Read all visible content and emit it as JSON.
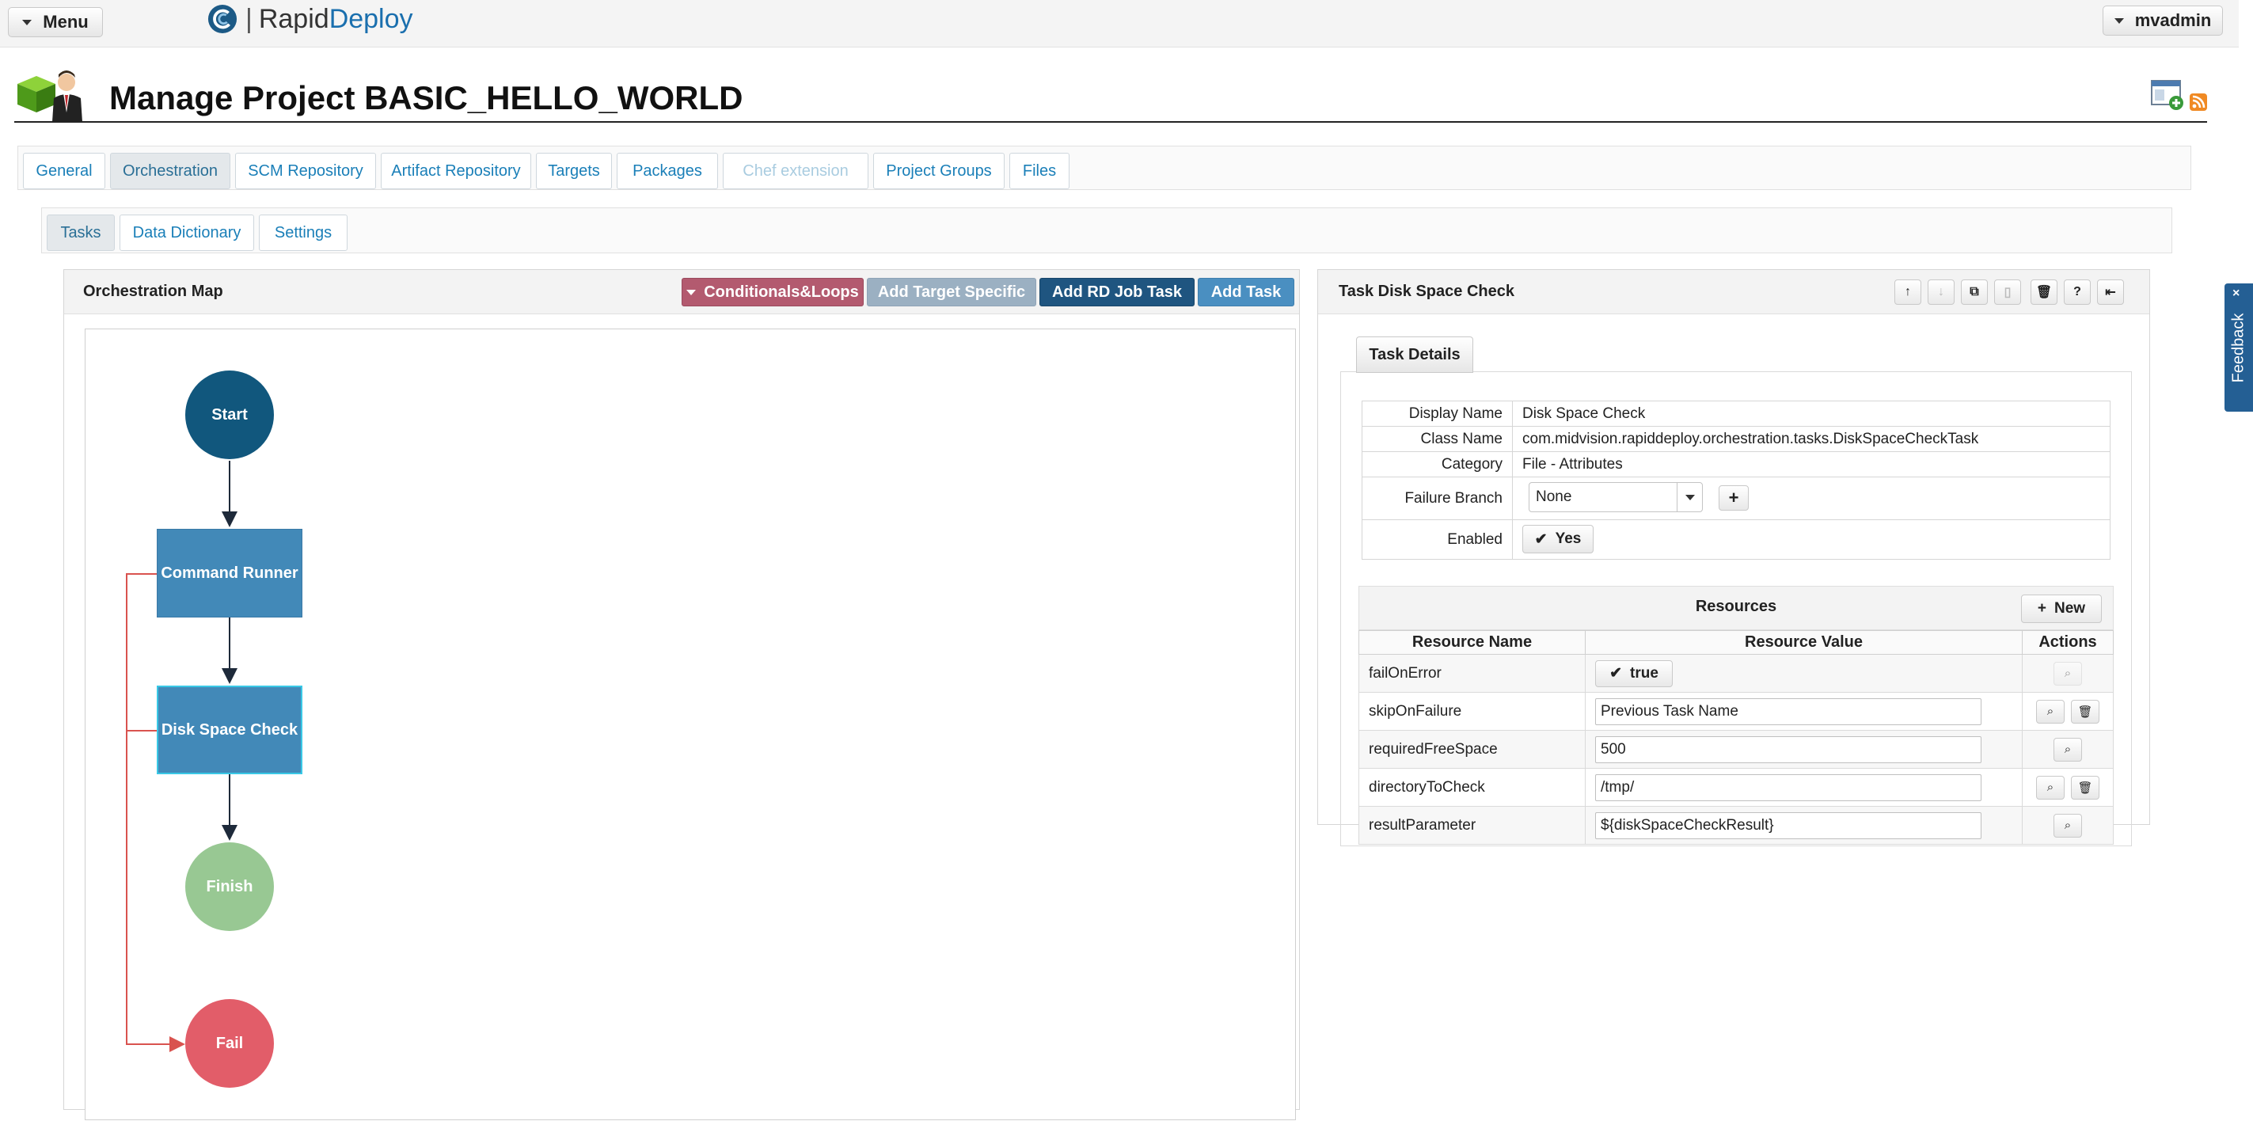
{
  "topbar": {
    "menu_label": "Menu",
    "brand": {
      "part1": "Rapid",
      "part2": "Deploy"
    },
    "user_label": "mvadmin"
  },
  "page": {
    "title": "Manage Project BASIC_HELLO_WORLD"
  },
  "main_tabs": [
    {
      "label": "General",
      "state": "normal"
    },
    {
      "label": "Orchestration",
      "state": "active"
    },
    {
      "label": "SCM Repository",
      "state": "normal"
    },
    {
      "label": "Artifact Repository",
      "state": "normal"
    },
    {
      "label": "Targets",
      "state": "normal"
    },
    {
      "label": "Packages",
      "state": "normal"
    },
    {
      "label": "Chef extension",
      "state": "disabled"
    },
    {
      "label": "Project Groups",
      "state": "normal"
    },
    {
      "label": "Files",
      "state": "normal"
    }
  ],
  "sub_tabs": [
    {
      "label": "Tasks",
      "state": "active"
    },
    {
      "label": "Data Dictionary",
      "state": "normal"
    },
    {
      "label": "Settings",
      "state": "normal"
    }
  ],
  "map": {
    "title": "Orchestration Map",
    "buttons": {
      "conditionals": "Conditionals&Loops",
      "target_specific": "Add Target Specific",
      "rd_job": "Add RD Job Task",
      "add_task": "Add Task"
    },
    "nodes": {
      "start": "Start",
      "command_runner": "Command Runner",
      "disk_space": "Disk Space Check",
      "finish": "Finish",
      "fail": "Fail"
    },
    "colors": {
      "start": "#11577d",
      "task": "#4289b8",
      "finish": "#98c893",
      "fail": "#e25d69",
      "edge": "#1e2a3a",
      "fail_edge": "#d9534f"
    }
  },
  "task": {
    "title": "Task Disk Space Check",
    "details_tab": "Task Details",
    "details": {
      "display_name_label": "Display Name",
      "display_name": "Disk Space Check",
      "class_name_label": "Class Name",
      "class_name": "com.midvision.rapiddeploy.orchestration.tasks.DiskSpaceCheckTask",
      "category_label": "Category",
      "category": "File - Attributes",
      "failure_branch_label": "Failure Branch",
      "failure_branch": "None",
      "enabled_label": "Enabled",
      "enabled": "Yes"
    },
    "resources": {
      "title": "Resources",
      "new_label": "New",
      "columns": [
        "Resource Name",
        "Resource Value",
        "Actions"
      ],
      "rows": [
        {
          "name": "failOnError",
          "value": "true"
        },
        {
          "name": "skipOnFailure",
          "value": "Previous Task Name"
        },
        {
          "name": "requiredFreeSpace",
          "value": "500"
        },
        {
          "name": "directoryToCheck",
          "value": "/tmp/"
        },
        {
          "name": "resultParameter",
          "value": "${diskSpaceCheckResult}"
        }
      ]
    }
  },
  "feedback": {
    "label": "Feedback"
  }
}
